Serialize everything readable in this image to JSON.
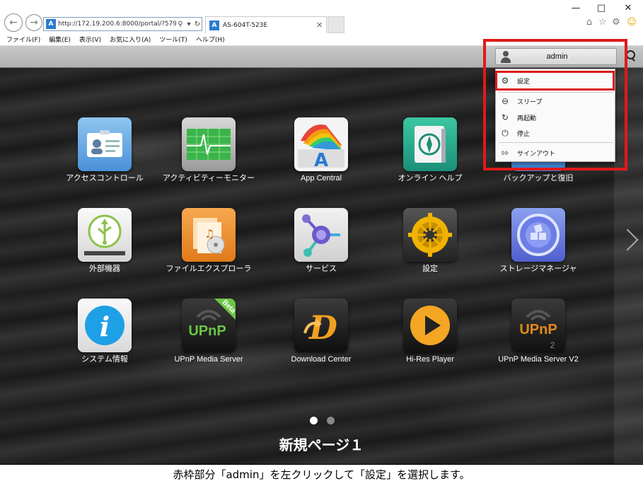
{
  "browser": {
    "url": "http://172.19.200.6:8000/portal/?579",
    "tab_title": "AS-604T-523E",
    "favicon_glyph": "A",
    "menu": [
      "ファイル(F)",
      "編集(E)",
      "表示(V)",
      "お気に入り(A)",
      "ツール(T)",
      "ヘルプ(H)"
    ]
  },
  "header": {
    "user_name": "admin"
  },
  "user_menu": {
    "items": [
      {
        "label": "設定",
        "icon": "gear-icon"
      },
      {
        "label": "スリープ",
        "icon": "sleep-icon"
      },
      {
        "label": "再起動",
        "icon": "restart-icon"
      },
      {
        "label": "停止",
        "icon": "power-icon"
      },
      {
        "label": "サインアウト",
        "icon": "signout-icon"
      }
    ]
  },
  "apps": [
    {
      "label": "アクセスコントロール",
      "icon": "access-control-icon",
      "color": "#4a90d9"
    },
    {
      "label": "アクティビティーモニター",
      "icon": "activity-monitor-icon",
      "color": "#55b33b"
    },
    {
      "label": "App Central",
      "icon": "app-central-icon",
      "color": "#ffffff"
    },
    {
      "label": "オンライン ヘルプ",
      "icon": "online-help-icon",
      "color": "#23a98f"
    },
    {
      "label": "バックアップと復旧",
      "icon": "backup-restore-icon",
      "color": "#3a7fd0"
    },
    {
      "label": "外部機器",
      "icon": "external-devices-icon",
      "color": "#8bc34a"
    },
    {
      "label": "ファイルエクスプローラ",
      "icon": "file-explorer-icon",
      "color": "#ef8a2a"
    },
    {
      "label": "サービス",
      "icon": "services-icon",
      "color": "#6a5acd"
    },
    {
      "label": "設定",
      "icon": "settings-icon",
      "color": "#f0b400"
    },
    {
      "label": "ストレージマネージャ",
      "icon": "storage-manager-icon",
      "color": "#5b6ee1"
    },
    {
      "label": "システム情報",
      "icon": "system-info-icon",
      "color": "#1ea0e6"
    },
    {
      "label": "UPnP Media Server",
      "icon": "upnp-media-server-icon",
      "color": "#6cc644",
      "badge": "Beta"
    },
    {
      "label": "Download Center",
      "icon": "download-center-icon",
      "color": "#f0a020"
    },
    {
      "label": "Hi-Res Player",
      "icon": "hires-player-icon",
      "color": "#f5a623"
    },
    {
      "label": "UPnP Media Server V2",
      "icon": "upnp-media-server-v2-icon",
      "color": "#e38b1a",
      "badge": "2"
    }
  ],
  "pager": {
    "page_title": "新規ページ１",
    "pages": 2,
    "current": 1
  },
  "caption": "赤枠部分「admin」を左クリックして「設定」を選択します。",
  "annotation_color": "#e01a1a"
}
